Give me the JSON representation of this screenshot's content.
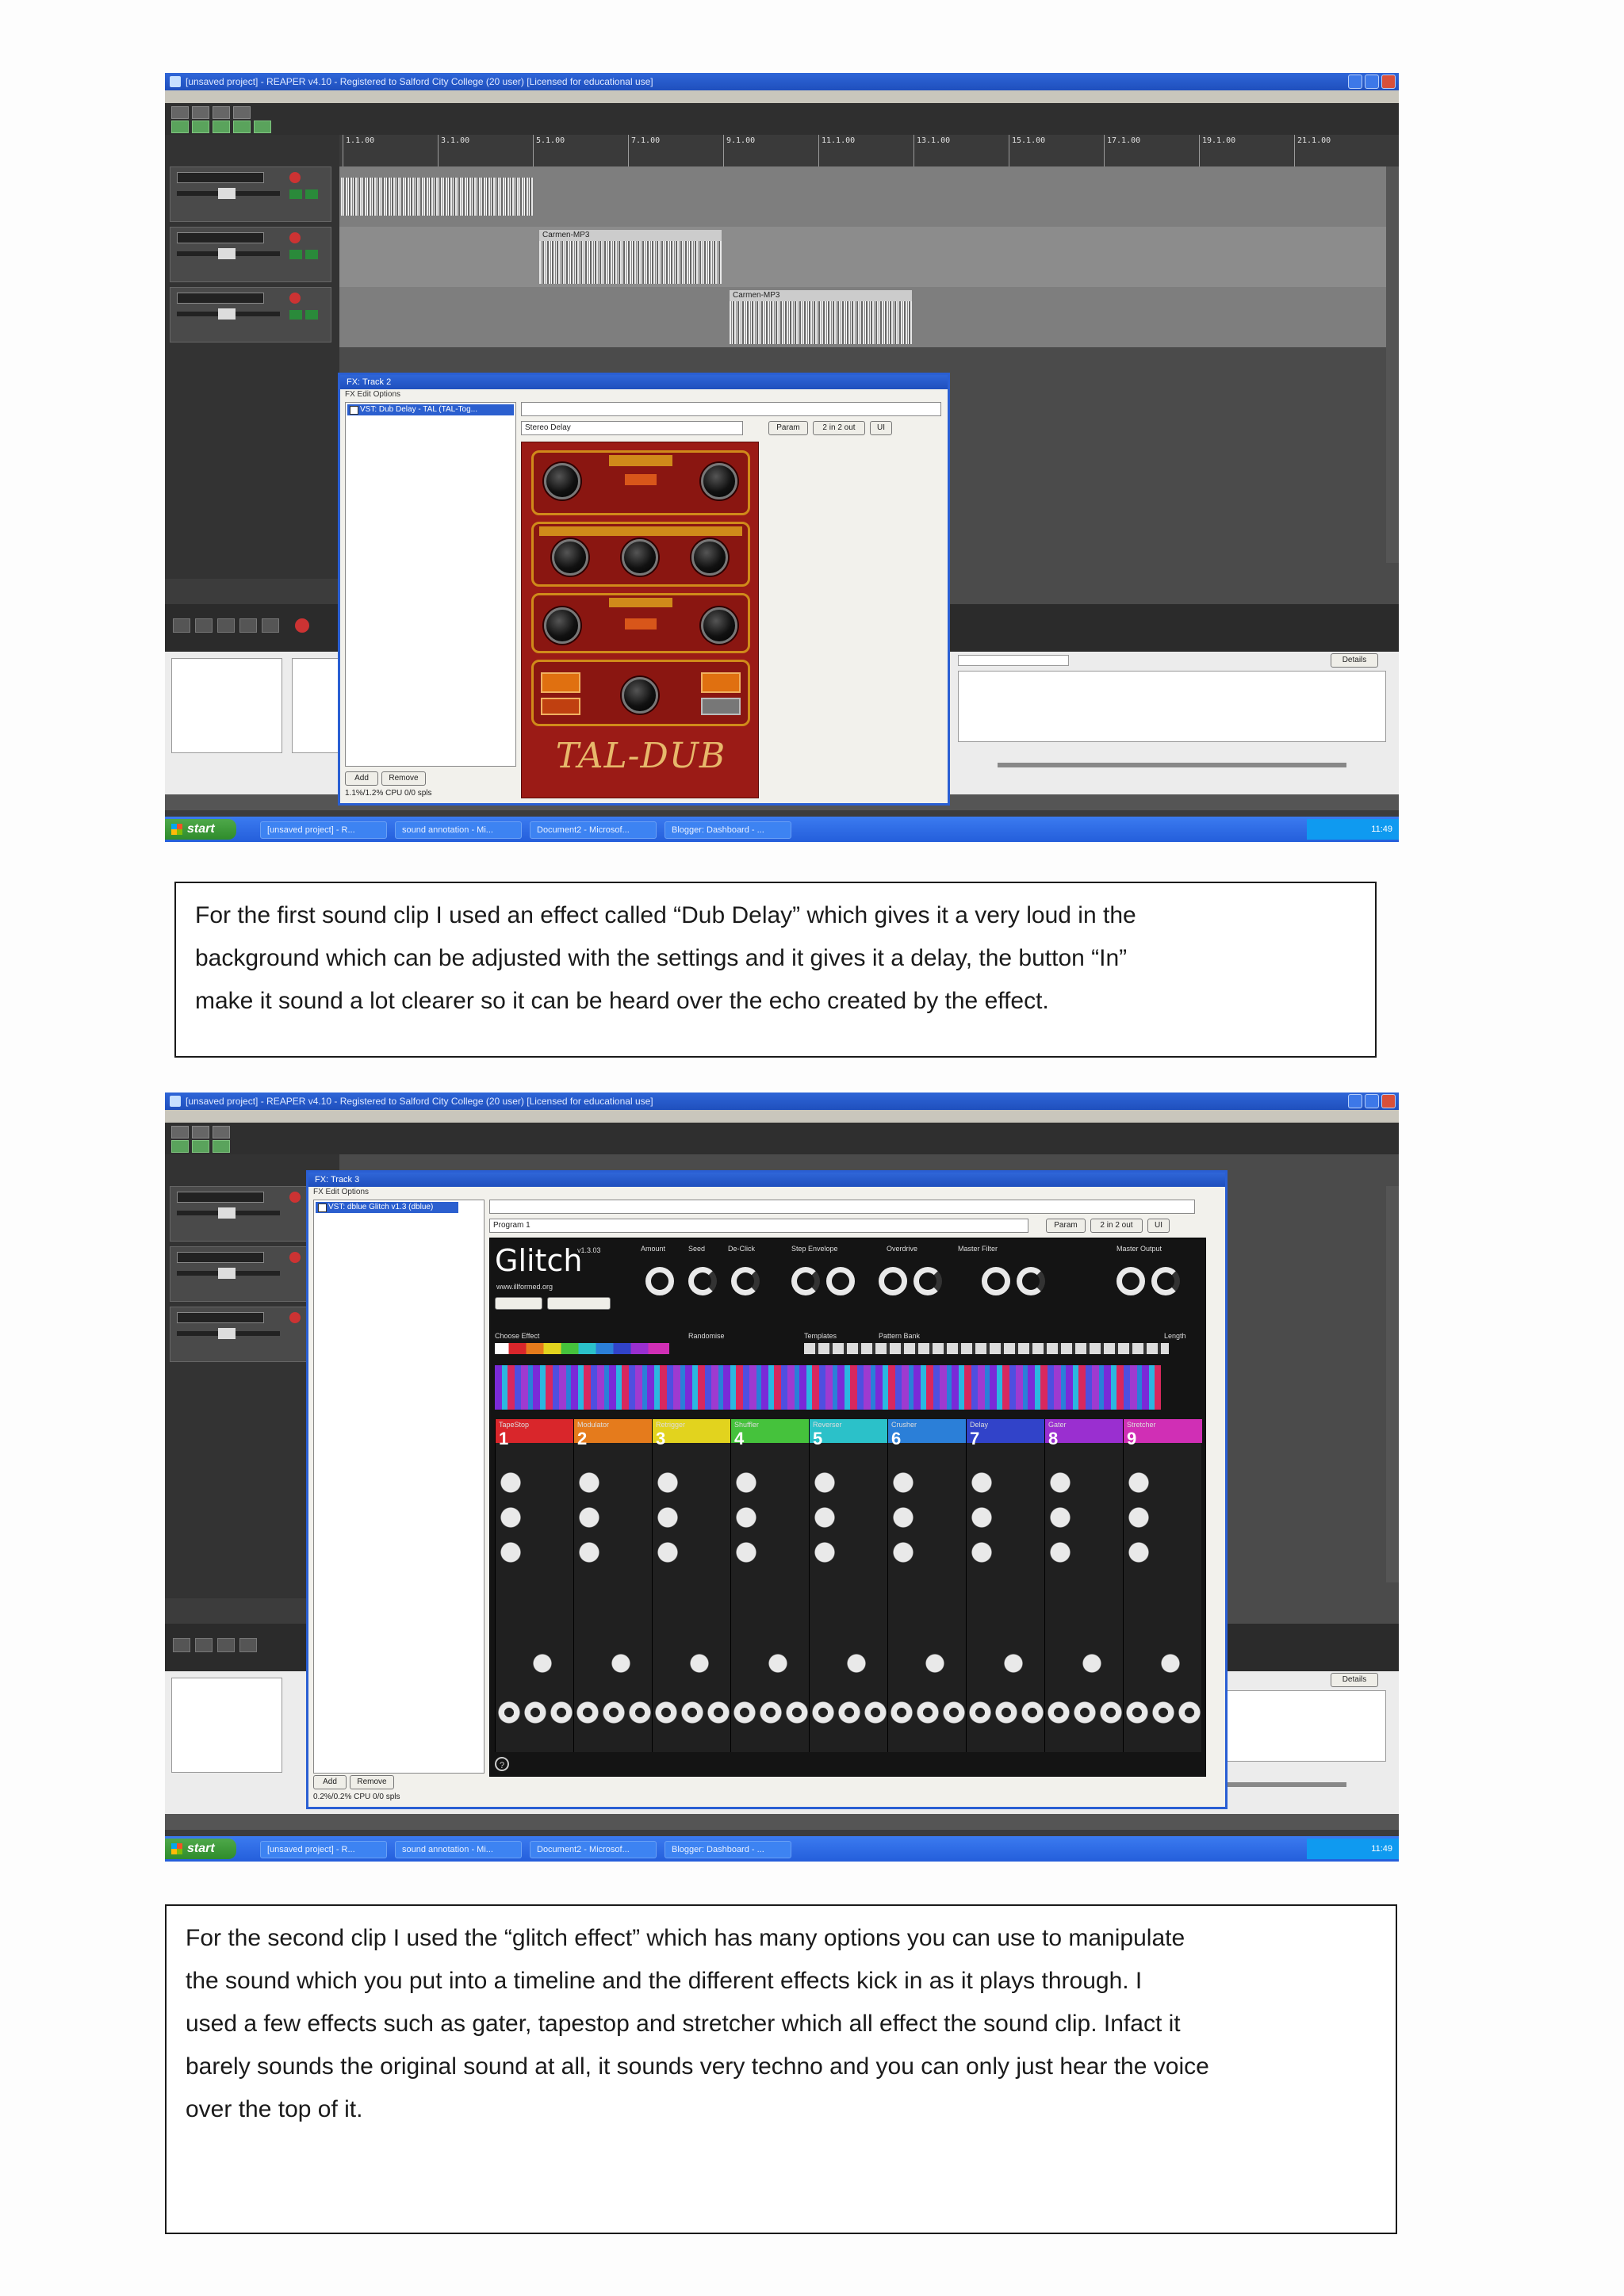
{
  "screenshot1": {
    "window_title": "[unsaved project] - REAPER v4.10 - Registered to Salford City College (20 user) [Licensed for educational use]",
    "ruler_labels": [
      "1.1.00",
      "3.1.00",
      "5.1.00",
      "7.1.00",
      "9.1.00",
      "11.1.00",
      "13.1.00",
      "15.1.00",
      "17.1.00",
      "19.1.00",
      "21.1.00"
    ],
    "clip_labels": [
      "Carmen-MP3",
      "Carmen-MP3"
    ],
    "fx_window": {
      "title": "FX: Track 2",
      "menu": "FX  Edit  Options",
      "plugin_entry": "VST: Dub Delay - TAL (TAL-Tog...",
      "preset": "Stereo Delay",
      "param_button": "Param",
      "io_button": "2 in 2 out",
      "ui_button": "UI",
      "add_button": "Add",
      "remove_button": "Remove",
      "cpu_text": "1.1%/1.2% CPU 0/0 spls",
      "plugin_logo": "TAL-DUB"
    },
    "details_label": "Details",
    "taskbar": {
      "start": "start",
      "tasks": [
        "[unsaved project] - R...",
        "sound annotation - Mi...",
        "Document2 - Microsof...",
        "Blogger: Dashboard - ..."
      ],
      "clock": "11:49"
    }
  },
  "text1": {
    "lines": [
      "For the first sound clip I used an effect called “Dub Delay” which gives it a very loud in the",
      "background which can be adjusted with the settings and it gives it a delay, the button “In”",
      "make it sound a lot clearer so it can be heard over the echo created by the effect."
    ]
  },
  "screenshot2": {
    "window_title": "[unsaved project] - REAPER v4.10 - Registered to Salford City College (20 user) [Licensed for educational use]",
    "fx_window": {
      "title": "FX: Track 3",
      "menu": "FX  Edit  Options",
      "plugin_entry": "VST: dblue Glitch v1.3 (dblue)",
      "preset": "Program 1",
      "param_button": "Param",
      "io_button": "2 in 2 out",
      "ui_button": "UI",
      "add_button": "Add",
      "remove_button": "Remove",
      "cpu_text": "0.2%/0.2% CPU 0/0 spls",
      "plugin_logo": "Glitch",
      "plugin_version": "v1.3.03",
      "plugin_url": "www.illformed.org",
      "headers": [
        "Amount",
        "Seed",
        "De-Click",
        "Step Envelope",
        "Overdrive",
        "Master Filter",
        "Master Output"
      ],
      "row2": [
        "Choose Effect",
        "Randomise",
        "Templates",
        "Pattern Bank",
        "Length"
      ],
      "effects": [
        "TapeStop",
        "Modulator",
        "Retrigger",
        "Shuffler",
        "Reverser",
        "Crusher",
        "Delay",
        "Gater",
        "Stretcher"
      ],
      "effect_colors": [
        "#d9262b",
        "#e57b1c",
        "#e2d31e",
        "#45c23c",
        "#2bc1c9",
        "#2b7fd8",
        "#3143c9",
        "#9a2fd0",
        "#d02fb5"
      ]
    },
    "details_label": "Details",
    "taskbar": {
      "start": "start",
      "tasks": [
        "[unsaved project] - R...",
        "sound annotation - Mi...",
        "Document2 - Microsof...",
        "Blogger: Dashboard - ..."
      ],
      "clock": "11:49"
    }
  },
  "text2": {
    "lines": [
      "For the second clip I used the “glitch effect” which has many options you can use to manipulate",
      "the sound which you put into a timeline and the different effects kick in as it plays through. I",
      "used a few effects such as gater, tapestop and stretcher which all effect the sound clip. Infact it",
      "barely sounds the original sound at all, it sounds very techno and you can only just hear the voice",
      "over the top of it."
    ]
  }
}
